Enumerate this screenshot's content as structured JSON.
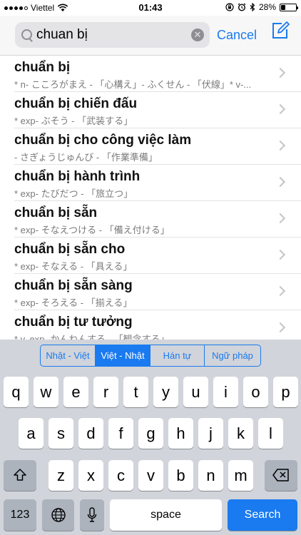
{
  "status_bar": {
    "carrier": "Viettel",
    "time": "01:43",
    "battery_percent": "28%",
    "battery_level": 0.28
  },
  "search": {
    "query": "chuan bị",
    "cancel_label": "Cancel"
  },
  "results": [
    {
      "word": "chuẩn bị",
      "definition": "* n- こころがまえ - 「心構え」- ふくせん - 「伏線」* v-..."
    },
    {
      "word": "chuẩn bị chiến đấu",
      "definition": "* exp- ぶそう - 「武装する」"
    },
    {
      "word": "chuẩn bị cho công việc làm",
      "definition": "- さぎょうじゅんび - 「作業準備」"
    },
    {
      "word": "chuẩn bị hành trình",
      "definition": "* exp- たびだつ - 「旅立つ」"
    },
    {
      "word": "chuẩn bị sẵn",
      "definition": "* exp- そなえつける - 「備え付ける」"
    },
    {
      "word": "chuẩn bị sẵn cho",
      "definition": "* exp- そなえる - 「具える」"
    },
    {
      "word": "chuẩn bị sẵn sàng",
      "definition": "* exp- そろえる - 「揃える」"
    },
    {
      "word": "chuẩn bị tư tưởng",
      "definition": "* v, exp- かんねんする - 「観念する」"
    }
  ],
  "dictionary_modes": [
    {
      "label": "Nhật - Việt",
      "active": false
    },
    {
      "label": "Việt - Nhật",
      "active": true
    },
    {
      "label": "Hán tự",
      "active": false
    },
    {
      "label": "Ngữ pháp",
      "active": false
    }
  ],
  "keyboard": {
    "row1": [
      "q",
      "w",
      "e",
      "r",
      "t",
      "y",
      "u",
      "i",
      "o",
      "p"
    ],
    "row2": [
      "a",
      "s",
      "d",
      "f",
      "g",
      "h",
      "j",
      "k",
      "l"
    ],
    "row3": [
      "z",
      "x",
      "c",
      "v",
      "b",
      "n",
      "m"
    ],
    "numbers_label": "123",
    "space_label": "space",
    "search_label": "Search"
  },
  "colors": {
    "accent": "#1a7af0",
    "keyboard_bg": "#d1d4da"
  }
}
